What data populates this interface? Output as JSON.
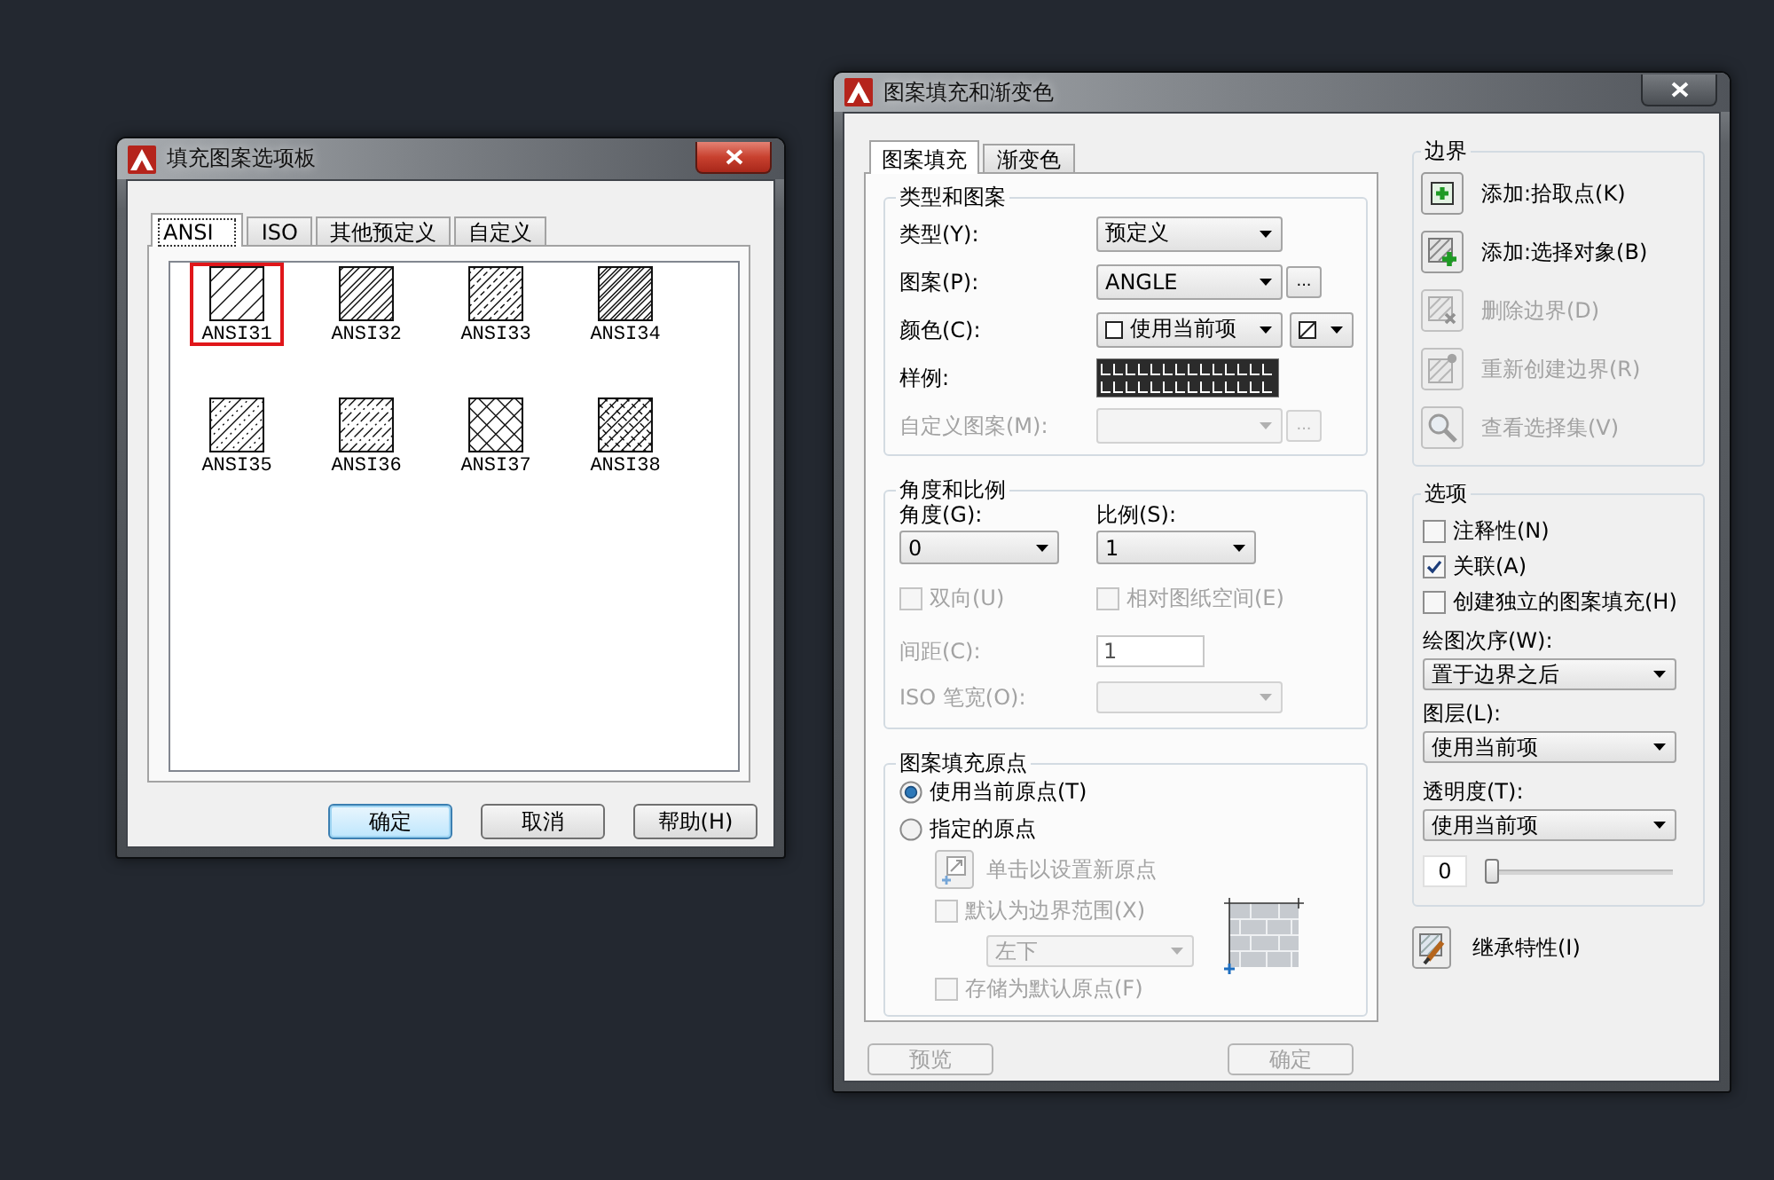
{
  "palette_window": {
    "title": "填充图案选项板",
    "active": true,
    "tabs": [
      {
        "label": "ANSI",
        "selected": true
      },
      {
        "label": "ISO",
        "selected": false
      },
      {
        "label": "其他预定义",
        "selected": false
      },
      {
        "label": "自定义",
        "selected": false
      }
    ],
    "patterns": [
      {
        "name": "ANSI31",
        "selected": true
      },
      {
        "name": "ANSI32",
        "selected": false
      },
      {
        "name": "ANSI33",
        "selected": false
      },
      {
        "name": "ANSI34",
        "selected": false
      },
      {
        "name": "ANSI35",
        "selected": false
      },
      {
        "name": "ANSI36",
        "selected": false
      },
      {
        "name": "ANSI37",
        "selected": false
      },
      {
        "name": "ANSI38",
        "selected": false
      }
    ],
    "buttons": [
      {
        "label": "确定",
        "default": true
      },
      {
        "label": "取消",
        "default": false
      },
      {
        "label": "帮助(H)",
        "default": false
      }
    ]
  },
  "hatch_window": {
    "title": "图案填充和渐变色",
    "active": false,
    "tabs": [
      {
        "label": "图案填充",
        "selected": true
      },
      {
        "label": "渐变色",
        "selected": false
      }
    ],
    "type_and_pattern": {
      "title": "类型和图案",
      "rows": [
        {
          "kind": "dropdown",
          "label": "类型(Y):",
          "value": "预定义",
          "disabled": false
        },
        {
          "kind": "browse",
          "label": "图案(P):",
          "value": "ANGLE",
          "button": "...",
          "disabled": false
        },
        {
          "kind": "color",
          "label": "颜色(C):",
          "value": "使用当前项",
          "disabled": false
        },
        {
          "kind": "swatch",
          "label": "样例:",
          "disabled": false
        },
        {
          "kind": "browse",
          "label": "自定义图案(M):",
          "button": "...",
          "disabled": true
        }
      ]
    },
    "angle_and_scale": {
      "title": "角度和比例",
      "fields": [
        {
          "label": "角度(G):",
          "value": "0"
        },
        {
          "label": "比例(S):",
          "value": "1"
        }
      ],
      "checkboxes": [
        {
          "label": "双向(U)",
          "checked": false,
          "disabled": true
        },
        {
          "label": "相对图纸空间(E)",
          "checked": false,
          "disabled": true
        }
      ],
      "spacing": {
        "label": "间距(C):",
        "value": "1",
        "disabled": true
      },
      "iso_pen_width": {
        "label": "ISO 笔宽(O):",
        "disabled": true
      }
    },
    "origin": {
      "title": "图案填充原点",
      "radios": [
        {
          "label": "使用当前原点(T)",
          "selected": true
        },
        {
          "label": "指定的原点",
          "selected": false
        }
      ],
      "set_origin": {
        "label": "单击以设置新原点",
        "disabled": true
      },
      "default_to_extents": {
        "label": "默认为边界范围(X)",
        "checked": false,
        "disabled": true
      },
      "position": {
        "value": "左下",
        "disabled": true
      },
      "store_as_default": {
        "label": "存储为默认原点(F)",
        "checked": false,
        "disabled": true
      }
    },
    "boundaries": {
      "title": "边界",
      "buttons": [
        {
          "label": "添加:拾取点(K)",
          "disabled": false
        },
        {
          "label": "添加:选择对象(B)",
          "disabled": false
        },
        {
          "label": "删除边界(D)",
          "disabled": true
        },
        {
          "label": "重新创建边界(R)",
          "disabled": true
        },
        {
          "label": "查看选择集(V)",
          "disabled": true
        }
      ]
    },
    "options": {
      "title": "选项",
      "checkboxes": [
        {
          "label": "注释性(N)",
          "checked": false
        },
        {
          "label": "关联(A)",
          "checked": true
        },
        {
          "label": "创建独立的图案填充(H)",
          "checked": false
        }
      ],
      "dropdowns": [
        {
          "label": "绘图次序(W):",
          "value": "置于边界之后"
        },
        {
          "label": "图层(L):",
          "value": "使用当前项"
        },
        {
          "label": "透明度(T):",
          "value": "使用当前项"
        }
      ],
      "transparency": {
        "value": "0",
        "level": 0
      }
    },
    "inherit_button": {
      "label": "继承特性(I)"
    },
    "footer_buttons": [
      {
        "label": "预览",
        "disabled": true
      },
      {
        "label": "确定",
        "disabled": true
      }
    ]
  }
}
